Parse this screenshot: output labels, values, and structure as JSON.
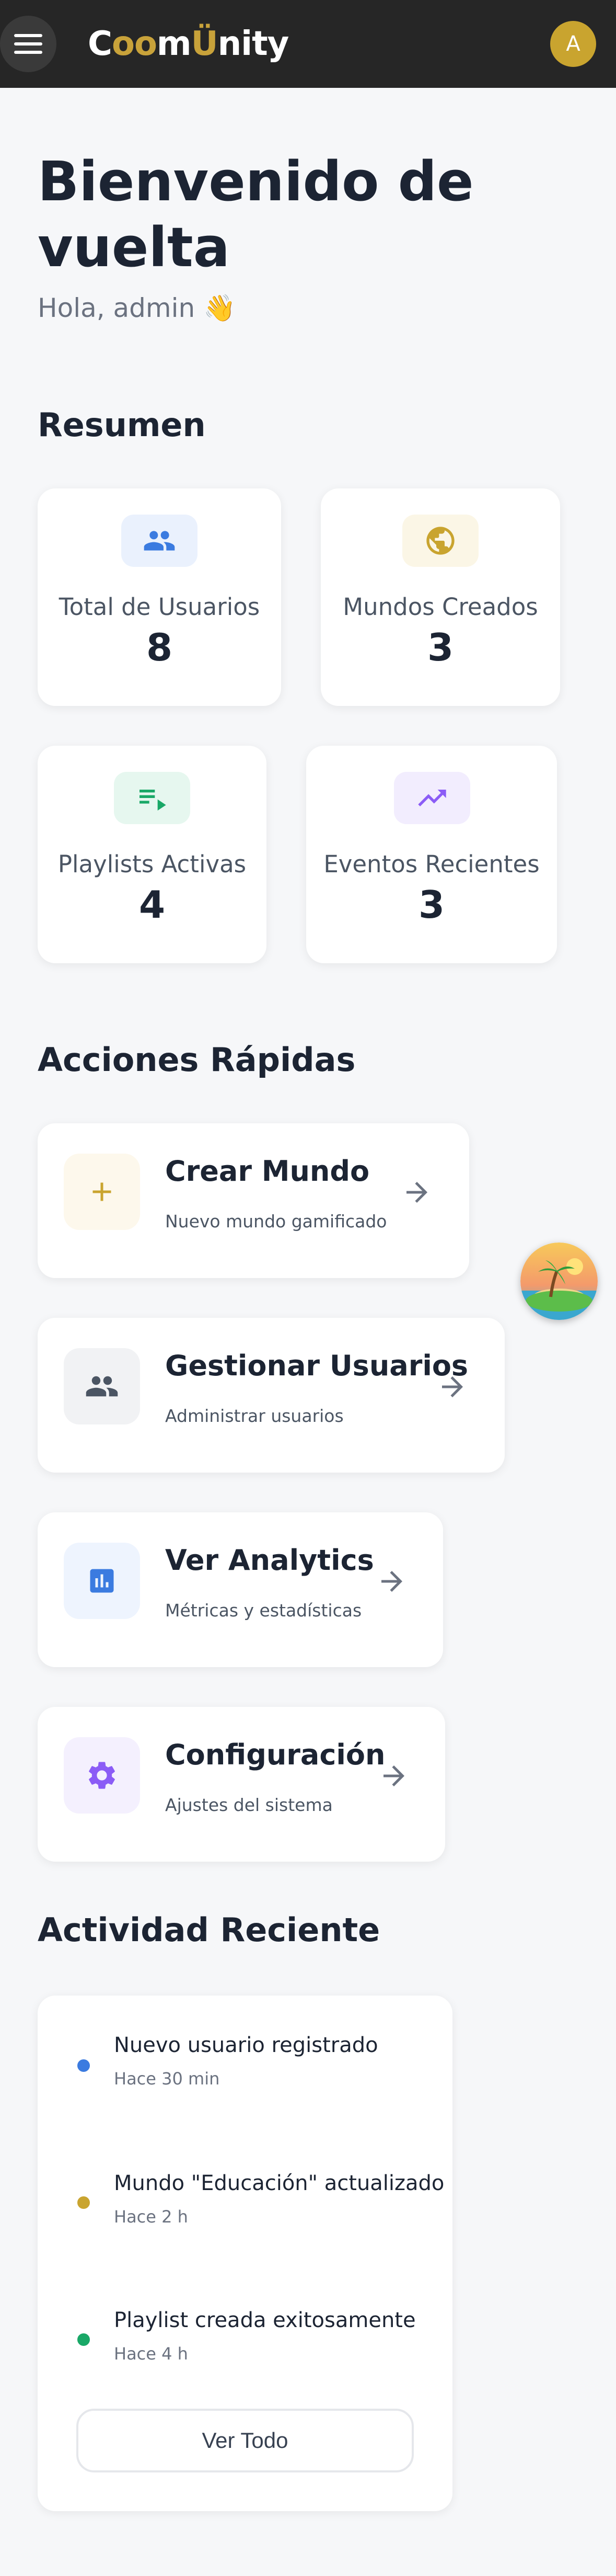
{
  "header": {
    "logo_text": "CoomÜnity",
    "avatar_initial": "A",
    "colors": {
      "bar": "#262626",
      "logo_accent": "#c8a23a",
      "avatar": "#c9a42f"
    },
    "icons": {
      "menu": "hamburger-menu-icon"
    }
  },
  "welcome": {
    "title": "Bienvenido de vuelta",
    "greeting": "Hola, admin 👋"
  },
  "summary": {
    "title": "Resumen",
    "cards": [
      {
        "label": "Total de Usuarios",
        "value": "8",
        "icon": "people-icon",
        "icon_color": "#3b7be0",
        "icon_bg": "#eaf1fd"
      },
      {
        "label": "Mundos Creados",
        "value": "3",
        "icon": "globe-icon",
        "icon_color": "#c9a42f",
        "icon_bg": "#fbf6e6"
      },
      {
        "label": "Playlists Activas",
        "value": "4",
        "icon": "playlist-play-icon",
        "icon_color": "#19a867",
        "icon_bg": "#e6f7ef"
      },
      {
        "label": "Eventos Recientes",
        "value": "3",
        "icon": "trending-up-icon",
        "icon_color": "#8b5cf6",
        "icon_bg": "#f2edfe"
      }
    ]
  },
  "quick_actions": {
    "title": "Acciones Rápidas",
    "items": [
      {
        "title": "Crear Mundo",
        "subtitle": "Nuevo mundo gamificado",
        "icon": "plus-icon",
        "icon_color": "#c9a42f",
        "icon_bg": "#fdf8ec"
      },
      {
        "title": "Gestionar Usuarios",
        "subtitle": "Administrar usuarios",
        "icon": "people-icon",
        "icon_color": "#4b5563",
        "icon_bg": "#f1f2f4"
      },
      {
        "title": "Ver Analytics",
        "subtitle": "Métricas y estadísticas",
        "icon": "bar-chart-icon",
        "icon_color": "#3b7be0",
        "icon_bg": "#eef4fe"
      },
      {
        "title": "Configuración",
        "subtitle": "Ajustes del sistema",
        "icon": "gear-icon",
        "icon_color": "#8b5cf6",
        "icon_bg": "#f4f0fe"
      }
    ]
  },
  "recent_activity": {
    "title": "Actividad Reciente",
    "items": [
      {
        "text": "Nuevo usuario registrado",
        "time": "Hace 30 min",
        "dot_color": "#3b7be0"
      },
      {
        "text": "Mundo \"Educación\" actualizado",
        "time": "Hace 2 h",
        "dot_color": "#c9a42f"
      },
      {
        "text": "Playlist creada exitosamente",
        "time": "Hace 4 h",
        "dot_color": "#19a867"
      }
    ],
    "view_all_label": "Ver Todo"
  },
  "floating_button": {
    "icon": "tropical-island-icon"
  }
}
